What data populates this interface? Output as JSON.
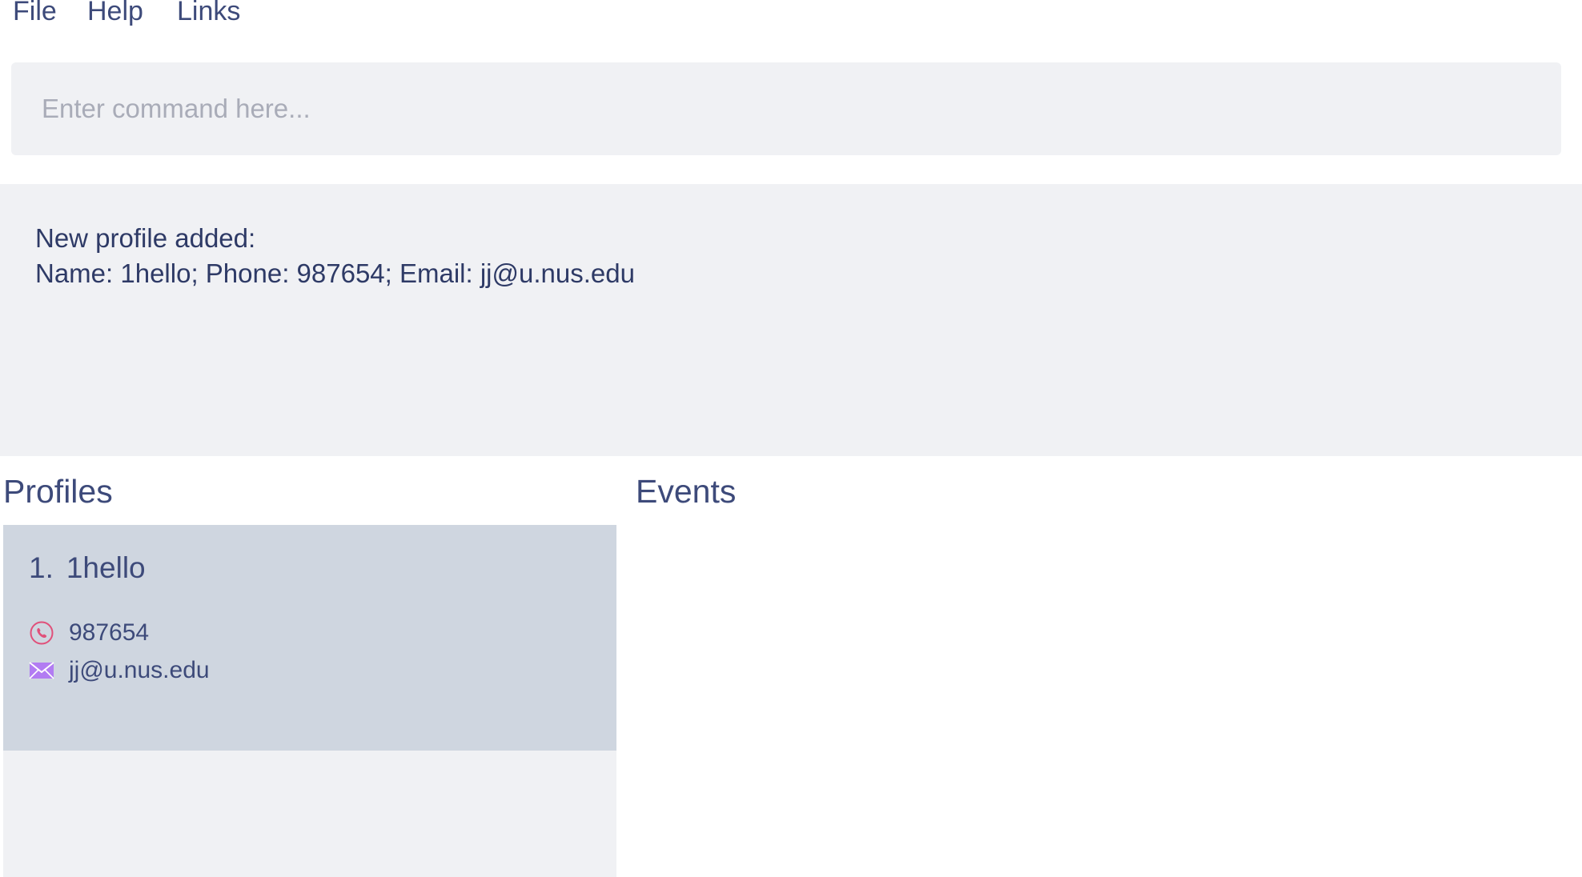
{
  "menu": {
    "file": "File",
    "help": "Help",
    "links": "Links"
  },
  "command": {
    "placeholder": "Enter command here...",
    "value": ""
  },
  "result": {
    "line1": "New profile added:",
    "line2": "Name: 1hello; Phone: 987654; Email: jj@u.nus.edu"
  },
  "sections": {
    "profiles": "Profiles",
    "events": "Events"
  },
  "profiles": [
    {
      "index": "1.",
      "name": "1hello",
      "phone": "987654",
      "email": "jj@u.nus.edu",
      "phone_icon": "phone-icon",
      "email_icon": "envelope-icon"
    }
  ],
  "colors": {
    "text": "#3d4a7a",
    "panel_bg": "#f0f1f4",
    "selected_card_bg": "#cfd6e0",
    "phone_icon": "#e0507a",
    "email_icon": "#b27cf2",
    "placeholder": "#a9acb8"
  }
}
